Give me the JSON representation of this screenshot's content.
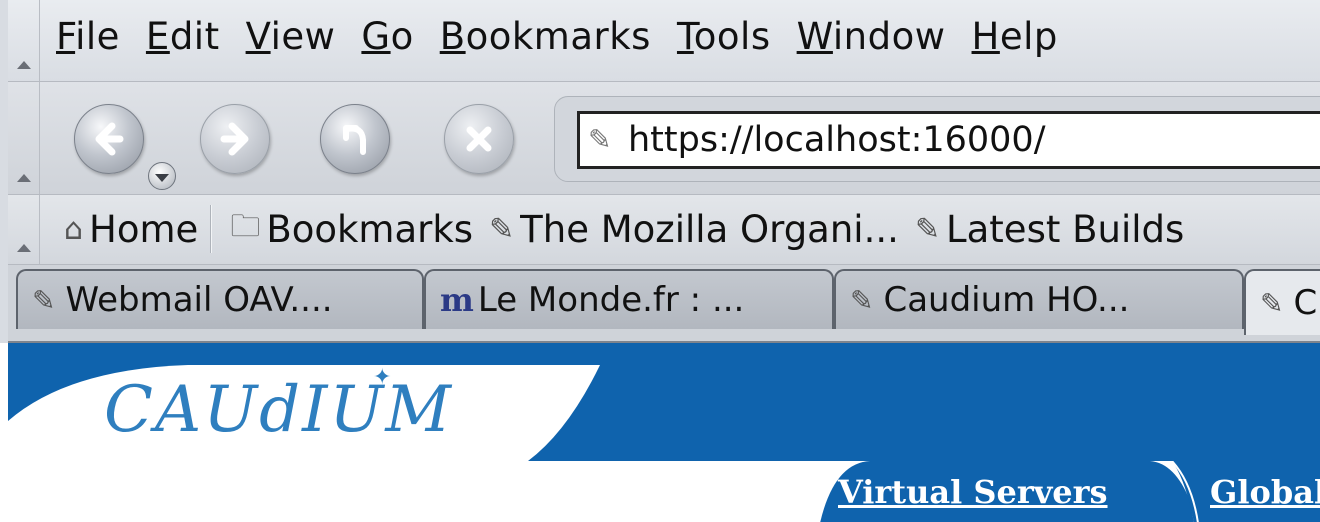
{
  "menubar": {
    "items": [
      "File",
      "Edit",
      "View",
      "Go",
      "Bookmarks",
      "Tools",
      "Window",
      "Help"
    ]
  },
  "navigation": {
    "url": "https://localhost:16000/",
    "buttons": [
      "back",
      "forward",
      "reload",
      "stop"
    ]
  },
  "personal_toolbar": {
    "home_label": "Home",
    "bookmarks_label": "Bookmarks",
    "links": [
      "The Mozilla Organi...",
      "Latest Builds"
    ]
  },
  "tabs": [
    {
      "label": "Webmail OAV...."
    },
    {
      "label": "Le Monde.fr : ...",
      "icon_glyph": "m"
    },
    {
      "label": "Caudium HO..."
    },
    {
      "label": "C"
    }
  ],
  "page": {
    "logo_text": "CAUdIUM",
    "nav_links": [
      "Virtual Servers",
      "Global"
    ],
    "colors": {
      "banner": "#0f63ad",
      "logo": "#2f7fbf"
    }
  }
}
